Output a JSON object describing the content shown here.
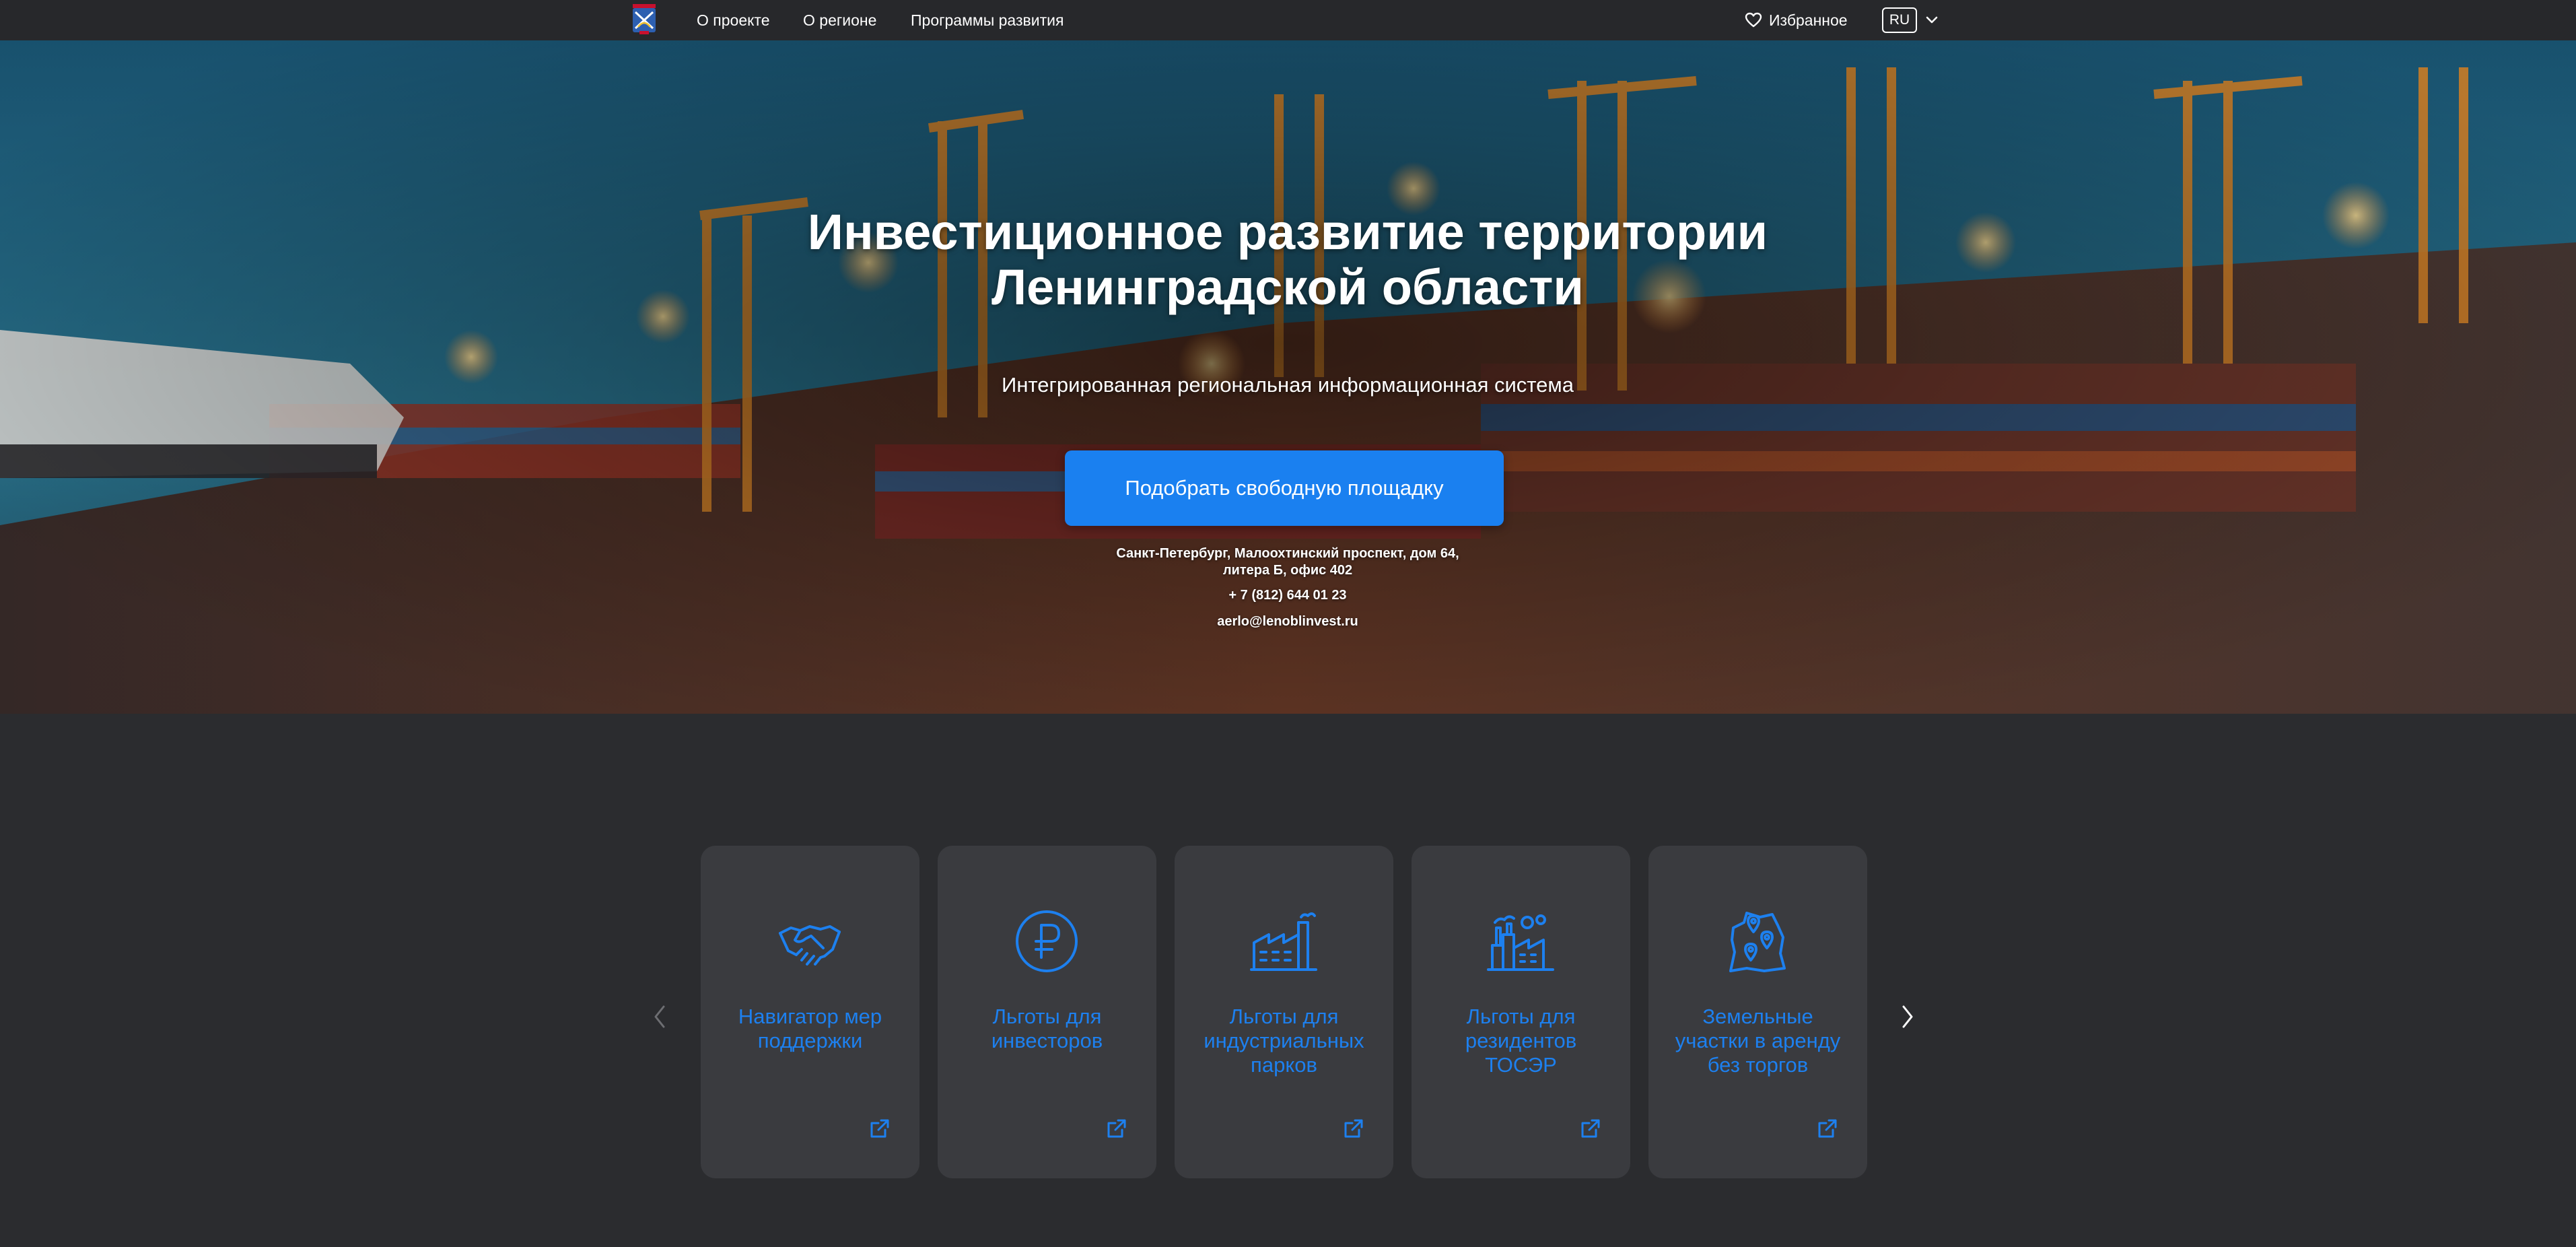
{
  "header": {
    "nav": [
      {
        "label": "О проекте"
      },
      {
        "label": "О регионе"
      },
      {
        "label": "Программы развития"
      }
    ],
    "favorites_label": "Избранное",
    "language": "RU"
  },
  "hero": {
    "title_line1": "Инвестиционное развитие территории",
    "title_line2": "Ленинградской области",
    "subtitle": "Интегрированная региональная информационная система",
    "cta_label": "Подобрать свободную площадку",
    "address_line1": "Санкт-Петербург, Малоохтинский проспект, дом 64,",
    "address_line2": "литера Б, офис 402",
    "phone": "+ 7 (812) 644 01 23",
    "email": "aerlo@lenoblinvest.ru"
  },
  "cards": [
    {
      "icon": "handshake-icon",
      "label": "Навигатор мер поддержки"
    },
    {
      "icon": "ruble-icon",
      "label": "Льготы для инвесторов"
    },
    {
      "icon": "factory-icon",
      "label": "Льготы для индустриальных парков"
    },
    {
      "icon": "plant-icon",
      "label": "Льготы для резидентов ТОСЭР"
    },
    {
      "icon": "map-pin-icon",
      "label": "Земельные участки в аренду без торгов"
    }
  ],
  "colors": {
    "accent": "#1a80f0",
    "card_bg": "#3a3b3f",
    "page_bg": "#2b2c2f",
    "topbar_bg": "#27282b"
  }
}
